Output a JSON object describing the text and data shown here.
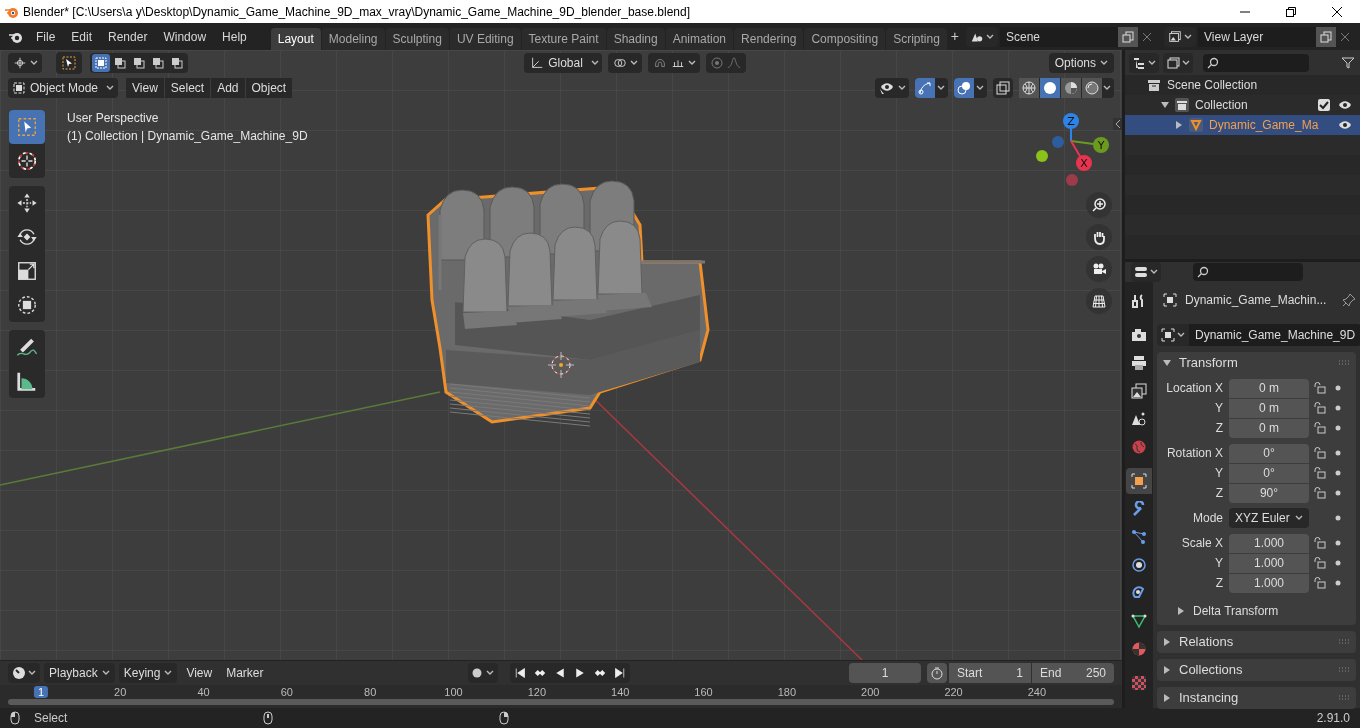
{
  "window": {
    "title": "Blender* [C:\\Users\\a y\\Desktop\\Dynamic_Game_Machine_9D_max_vray\\Dynamic_Game_Machine_9D_blender_base.blend]"
  },
  "menu": [
    "File",
    "Edit",
    "Render",
    "Window",
    "Help"
  ],
  "workspaces": [
    {
      "label": "Layout",
      "selected": true
    },
    {
      "label": "Modeling",
      "selected": false
    },
    {
      "label": "Sculpting",
      "selected": false
    },
    {
      "label": "UV Editing",
      "selected": false
    },
    {
      "label": "Texture Paint",
      "selected": false
    },
    {
      "label": "Shading",
      "selected": false
    },
    {
      "label": "Animation",
      "selected": false
    },
    {
      "label": "Rendering",
      "selected": false
    },
    {
      "label": "Compositing",
      "selected": false
    },
    {
      "label": "Scripting",
      "selected": false
    }
  ],
  "add_workspace": "+",
  "scene": "Scene",
  "view_layer": "View Layer",
  "viewport": {
    "orientation": "Global",
    "options": "Options",
    "mode": "Object Mode",
    "menus": [
      "View",
      "Select",
      "Add",
      "Object"
    ],
    "info": [
      "User Perspective",
      "(1) Collection | Dynamic_Game_Machine_9D"
    ],
    "tools": [
      {
        "kind": "select",
        "selected": true
      },
      {
        "kind": "cursor",
        "selected": false
      },
      {
        "kind": "move",
        "selected": false
      },
      {
        "kind": "rotate",
        "selected": false
      },
      {
        "kind": "scale",
        "selected": false
      },
      {
        "kind": "transform",
        "selected": false
      },
      {
        "kind": "annotate",
        "selected": false
      },
      {
        "kind": "measure",
        "selected": false
      }
    ],
    "shading": [
      {
        "kind": "wireframe",
        "selected": false
      },
      {
        "kind": "solid",
        "selected": true
      },
      {
        "kind": "material",
        "selected": false
      },
      {
        "kind": "rendered",
        "selected": false
      }
    ],
    "axes": [
      {
        "label": "Z",
        "color": "#2e83e6"
      },
      {
        "label": "Y",
        "color": "#6b9a1f"
      },
      {
        "label": "X",
        "color": "#e8344e"
      }
    ]
  },
  "outliner": {
    "tree": [
      {
        "label": "Scene Collection",
        "kind": "scene",
        "children": [
          {
            "label": "Collection",
            "kind": "collection",
            "expanded": true,
            "checked": true,
            "children": [
              {
                "label": "Dynamic_Game_Ma",
                "kind": "mesh",
                "expanded": false,
                "selected": true
              }
            ]
          }
        ]
      }
    ]
  },
  "properties": {
    "tabs": [
      {
        "kind": "tool",
        "selected": false
      },
      {
        "kind": "render",
        "selected": false
      },
      {
        "kind": "output",
        "selected": false
      },
      {
        "kind": "view_layer",
        "selected": false
      },
      {
        "kind": "scene",
        "selected": false
      },
      {
        "kind": "world",
        "selected": false
      },
      {
        "kind": "object",
        "selected": true
      },
      {
        "kind": "modifiers",
        "selected": false
      },
      {
        "kind": "particles",
        "selected": false
      },
      {
        "kind": "physics",
        "selected": false
      },
      {
        "kind": "constraints",
        "selected": false
      },
      {
        "kind": "data",
        "selected": false
      },
      {
        "kind": "material",
        "selected": false
      },
      {
        "kind": "texture",
        "selected": false
      }
    ],
    "object_name": "Dynamic_Game_Machin...",
    "data_name": "Dynamic_Game_Machine_9D",
    "panels": [
      {
        "title": "Transform",
        "expanded": true,
        "groups": [
          [
            {
              "label": "Location X",
              "value": "0 m",
              "kind": "number"
            },
            {
              "label": "Y",
              "value": "0 m",
              "kind": "number"
            },
            {
              "label": "Z",
              "value": "0 m",
              "kind": "number"
            }
          ],
          [
            {
              "label": "Rotation X",
              "value": "0°",
              "kind": "number"
            },
            {
              "label": "Y",
              "value": "0°",
              "kind": "number"
            },
            {
              "label": "Z",
              "value": "90°",
              "kind": "number"
            }
          ],
          [
            {
              "label": "Mode",
              "value": "XYZ Euler",
              "kind": "dropdown"
            }
          ],
          [
            {
              "label": "Scale X",
              "value": "1.000",
              "kind": "number"
            },
            {
              "label": "Y",
              "value": "1.000",
              "kind": "number"
            },
            {
              "label": "Z",
              "value": "1.000",
              "kind": "number"
            }
          ]
        ],
        "subpanels": [
          {
            "title": "Delta Transform",
            "expanded": false
          }
        ]
      },
      {
        "title": "Relations",
        "expanded": false
      },
      {
        "title": "Collections",
        "expanded": false
      },
      {
        "title": "Instancing",
        "expanded": false
      }
    ]
  },
  "timeline": {
    "menus": [
      "Playback",
      "Keying",
      "View",
      "Marker"
    ],
    "frame": "1",
    "start_label": "Start",
    "start": "1",
    "end_label": "End",
    "end": "250",
    "ruler": [
      {
        "label": "1",
        "selected": true
      },
      {
        "label": "20",
        "selected": false
      },
      {
        "label": "40",
        "selected": false
      },
      {
        "label": "60",
        "selected": false
      },
      {
        "label": "80",
        "selected": false
      },
      {
        "label": "100",
        "selected": false
      },
      {
        "label": "120",
        "selected": false
      },
      {
        "label": "140",
        "selected": false
      },
      {
        "label": "160",
        "selected": false
      },
      {
        "label": "180",
        "selected": false
      },
      {
        "label": "200",
        "selected": false
      },
      {
        "label": "220",
        "selected": false
      },
      {
        "label": "240",
        "selected": false
      }
    ]
  },
  "status": {
    "hint": "Select",
    "version": "2.91.0"
  }
}
